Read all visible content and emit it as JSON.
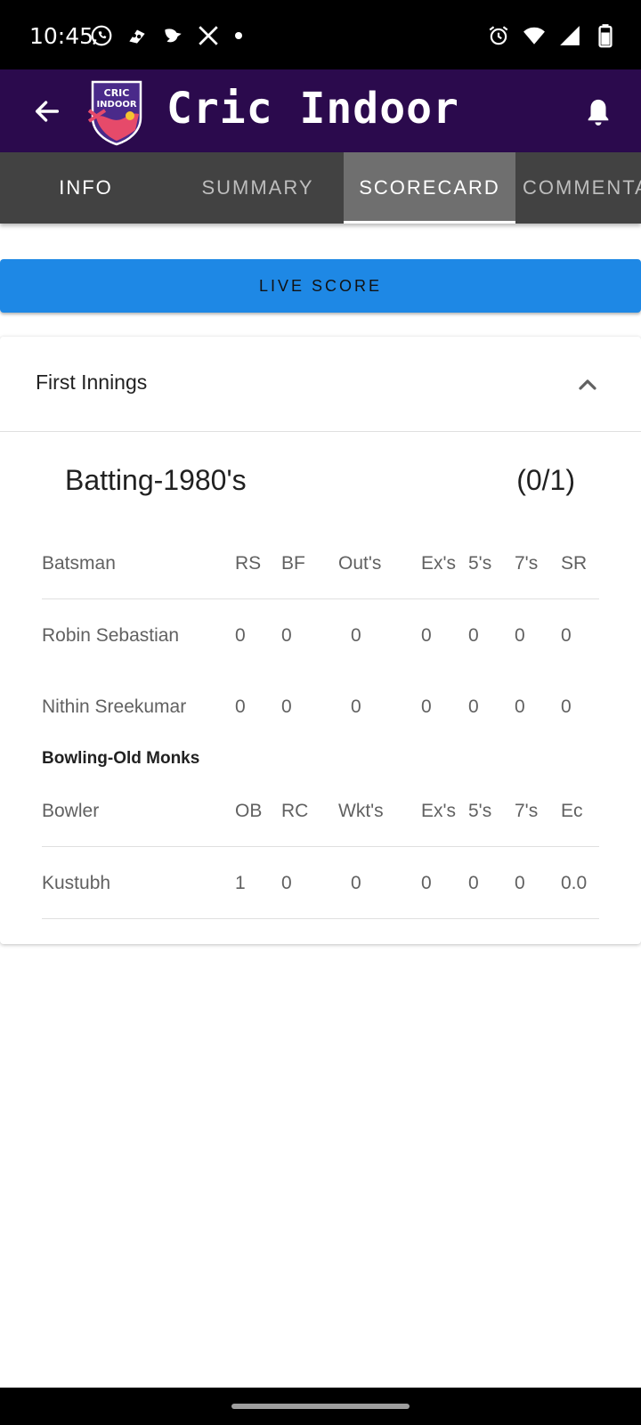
{
  "status_bar": {
    "time": "10:45",
    "left_icons": [
      "whatsapp-icon",
      "app-icon",
      "bird-icon",
      "x-icon",
      "dot-icon"
    ],
    "right_icons": [
      "alarm-icon",
      "wifi-icon",
      "signal-icon",
      "battery-icon"
    ]
  },
  "app_bar": {
    "title": "Cric Indoor",
    "logo_line1": "CRIC",
    "logo_line2": "INDOOR",
    "back_icon": "arrow-left-icon",
    "bell_icon": "bell-icon",
    "background": "#2b0a4d"
  },
  "tabs": [
    {
      "label": "INFO",
      "active": false
    },
    {
      "label": "SUMMARY",
      "active": false
    },
    {
      "label": "SCORECARD",
      "active": true
    },
    {
      "label": "COMMENTA",
      "active": false
    }
  ],
  "live_score_button": {
    "label": "LIVE SCORE",
    "color": "#1e88e5"
  },
  "innings": {
    "title": "First Innings",
    "expanded": true,
    "batting": {
      "title": "Batting-1980's",
      "score": "(0/1)",
      "headers": [
        "Batsman",
        "RS",
        "BF",
        "Out's",
        "Ex's",
        "5's",
        "7's",
        "SR"
      ],
      "rows": [
        {
          "name": "Robin Sebastian",
          "rs": "0",
          "bf": "0",
          "outs": "0",
          "ex": "0",
          "fives": "0",
          "sevens": "0",
          "sr": "0"
        },
        {
          "name": "Nithin Sreekumar",
          "rs": "0",
          "bf": "0",
          "outs": "0",
          "ex": "0",
          "fives": "0",
          "sevens": "0",
          "sr": "0"
        }
      ]
    },
    "bowling": {
      "title": "Bowling-Old Monks",
      "headers": [
        "Bowler",
        "OB",
        "RC",
        "Wkt's",
        "Ex's",
        "5's",
        "7's",
        "Ec"
      ],
      "rows": [
        {
          "name": "Kustubh",
          "ob": "1",
          "rc": "0",
          "wkts": "0",
          "ex": "0",
          "fives": "0",
          "sevens": "0",
          "ec": "0.0"
        }
      ]
    }
  }
}
